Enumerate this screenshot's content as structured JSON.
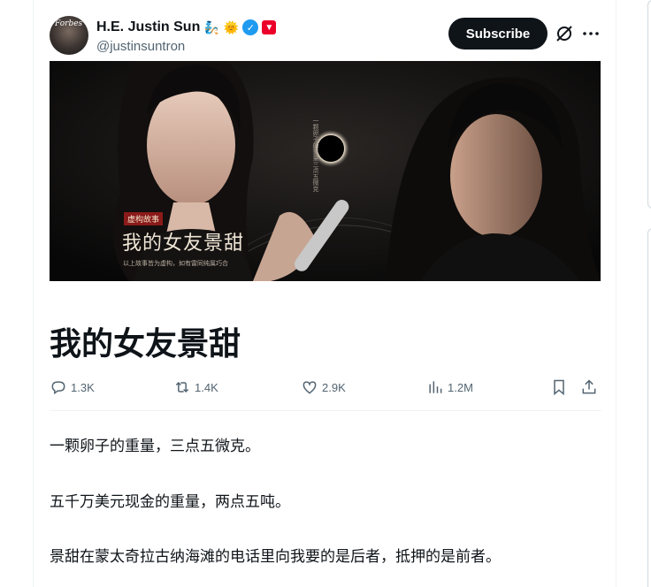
{
  "author": {
    "display_name": "H.E. Justin Sun",
    "handle": "@justinsuntron",
    "avatar_label": "Forbes",
    "badges": [
      "genie-emoji",
      "sun-emoji",
      "verified-badge",
      "tron-badge"
    ],
    "colors": {
      "verified": "#1d9bf0",
      "tron": "#eb0029"
    }
  },
  "header": {
    "subscribe_label": "Subscribe",
    "icons": [
      "grok-icon",
      "more-icon"
    ]
  },
  "banner": {
    "tag": "虚构故事",
    "title": "我的女友景甜",
    "subtitle": "以上故事皆为虚构，如有雷同纯属巧合",
    "vertical_text": "一颗卵子的重量三点五微克"
  },
  "article": {
    "title": "我的女友景甜",
    "paragraphs": [
      "一颗卵子的重量，三点五微克。",
      "五千万美元现金的重量，两点五吨。",
      "景甜在蒙太奇拉古纳海滩的电话里向我要的是后者，抵押的是前者。"
    ]
  },
  "actions": {
    "replies": "1.3K",
    "reposts": "1.4K",
    "likes": "2.9K",
    "views": "1.2M"
  }
}
